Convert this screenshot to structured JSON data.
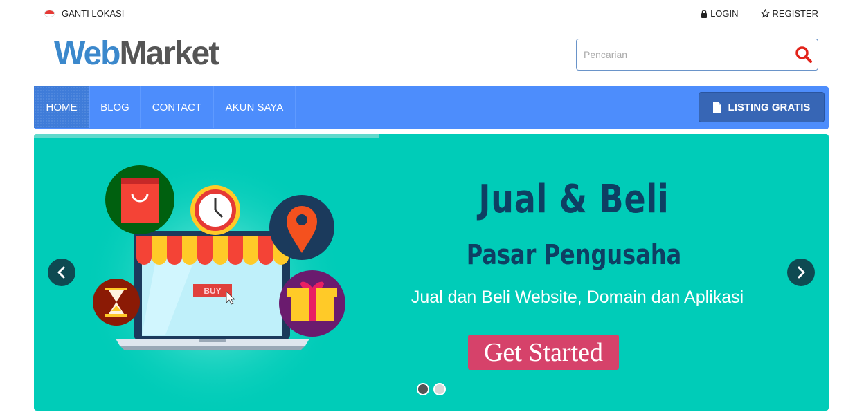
{
  "topbar": {
    "location_label": "GANTI LOKASI",
    "login_label": "LOGIN",
    "register_label": "REGISTER"
  },
  "logo": {
    "part1": "Web",
    "part2": "Market"
  },
  "search": {
    "placeholder": "Pencarian"
  },
  "nav": {
    "items": [
      {
        "label": "HOME",
        "active": true
      },
      {
        "label": "BLOG",
        "active": false
      },
      {
        "label": "CONTACT",
        "active": false
      },
      {
        "label": "AKUN SAYA",
        "active": false
      }
    ],
    "listing_label": "LISTING GRATIS"
  },
  "hero": {
    "headline": "Jual & Beli",
    "subheadline": "Pasar Pengusaha",
    "tagline": "Jual dan Beli Website, Domain dan Aplikasi",
    "cta_label": "Get Started",
    "buy_label": "BUY",
    "active_slide": 1,
    "slide_count": 2
  },
  "colors": {
    "brand_blue": "#3b88cc",
    "nav_blue": "#4d8dfc",
    "hero_teal": "#00ccb8",
    "cta_pink": "#d6426a",
    "search_red": "#e2231a"
  }
}
